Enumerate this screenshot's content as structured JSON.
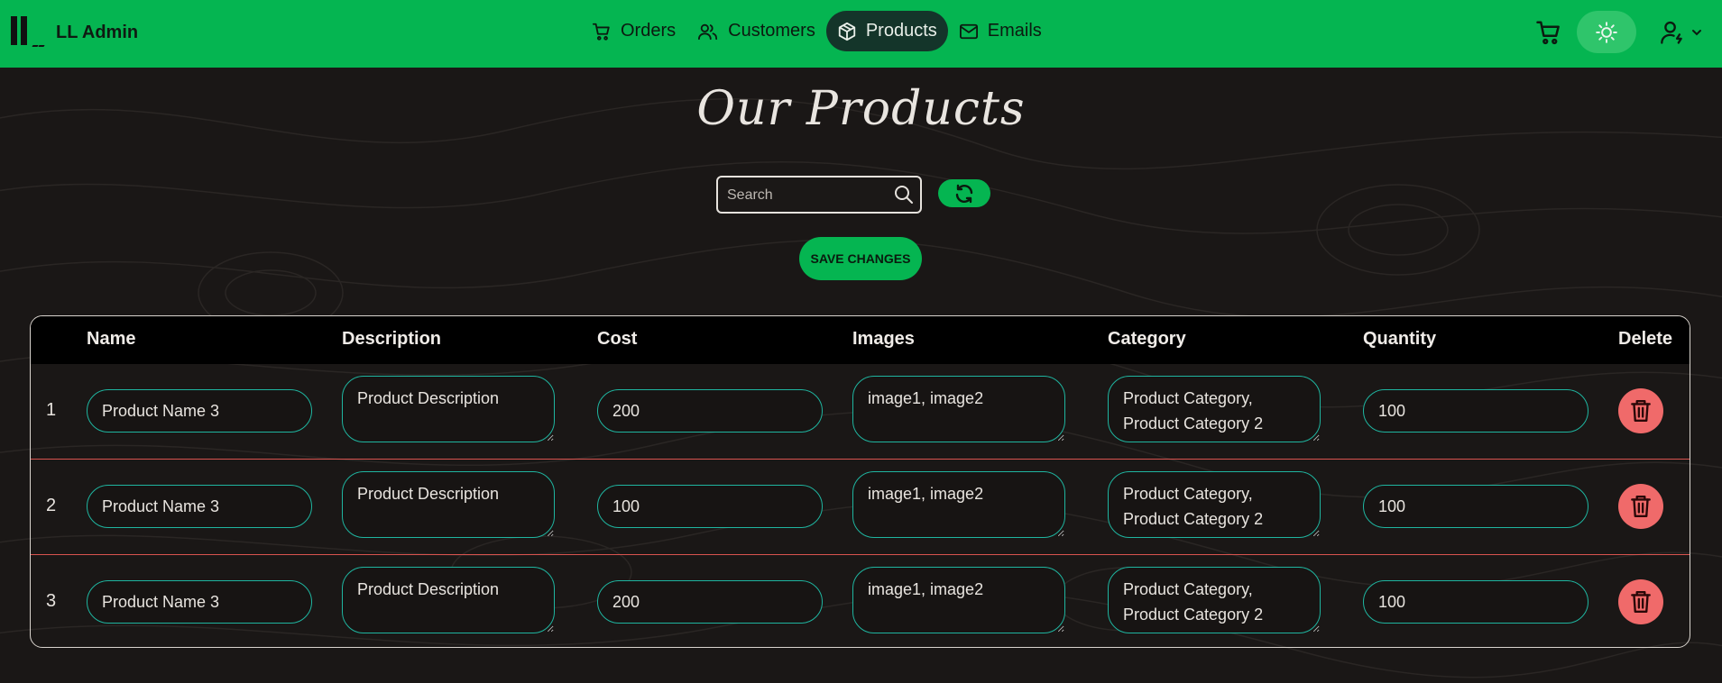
{
  "brand": {
    "name": "LL Admin"
  },
  "nav": {
    "items": [
      {
        "label": "Orders",
        "icon": "cart-icon",
        "active": false
      },
      {
        "label": "Customers",
        "icon": "users-icon",
        "active": false
      },
      {
        "label": "Products",
        "icon": "box-icon",
        "active": true
      },
      {
        "label": "Emails",
        "icon": "mail-icon",
        "active": false
      }
    ]
  },
  "header_actions": {
    "cart_icon": "cart-icon",
    "theme_icon": "sun-icon",
    "user_icon": "user-settings-icon"
  },
  "page": {
    "title": "Our Products"
  },
  "search": {
    "placeholder": "Search",
    "value": ""
  },
  "save_label": "SAVE CHANGES",
  "table": {
    "columns": [
      "Name",
      "Description",
      "Cost",
      "Images",
      "Category",
      "Quantity",
      "Delete"
    ],
    "rows": [
      {
        "num": "1",
        "name": "Product Name 3",
        "description": "Product Description",
        "cost": "200",
        "images": "image1, image2",
        "category": "Product Category, Product Category 2",
        "quantity": "100"
      },
      {
        "num": "2",
        "name": "Product Name 3",
        "description": "Product Description",
        "cost": "100",
        "images": "image1, image2",
        "category": "Product Category, Product Category 2",
        "quantity": "100"
      },
      {
        "num": "3",
        "name": "Product Name 3",
        "description": "Product Description",
        "cost": "200",
        "images": "image1, image2",
        "category": "Product Category, Product Category 2",
        "quantity": "100"
      }
    ]
  },
  "colors": {
    "accent": "#05b551",
    "background": "#1a1716",
    "field_border": "#1fb5a0",
    "delete": "#f06a6a",
    "row_separator": "#d9534f"
  }
}
